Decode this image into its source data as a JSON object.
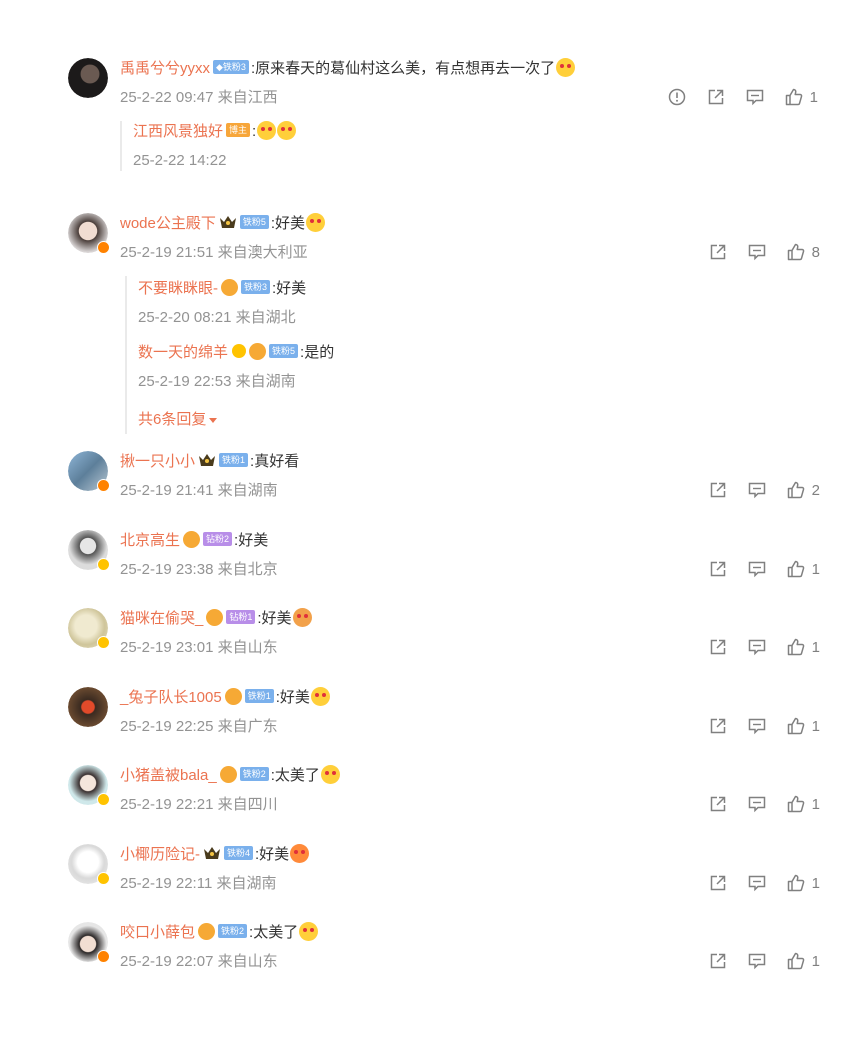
{
  "comments": [
    {
      "user": "禹禹兮兮yyxx",
      "fan_badge": "◆铁粉3",
      "text": ":原来春天的葛仙村这么美，有点想再去一次了",
      "meta": "25-2-22 09:47 来自江西",
      "likes": "1",
      "replies": [
        {
          "user": "江西风景独好",
          "badge": "博主",
          "text": ":",
          "meta": "25-2-22 14:22"
        }
      ]
    },
    {
      "user": "wode公主殿下",
      "fan_badge": "铁粉5",
      "text": ":好美",
      "meta": "25-2-19 21:51 来自澳大利亚",
      "likes": "8",
      "replies": [
        {
          "user": "不要眯眯眼-",
          "badge": "铁粉3",
          "text": ":好美",
          "meta": "25-2-20 08:21 来自湖北"
        },
        {
          "user": "数一天的绵羊",
          "badge": "铁粉5",
          "text": ":是的",
          "meta": "25-2-19 22:53 来自湖南"
        }
      ],
      "more_replies": "共6条回复"
    },
    {
      "user": "揪一只小小",
      "fan_badge": "铁粉1",
      "text": ":真好看",
      "meta": "25-2-19 21:41 来自湖南",
      "likes": "2"
    },
    {
      "user": "北京高生",
      "fan_badge": "钻粉2",
      "text": ":好美",
      "meta": "25-2-19 23:38 来自北京",
      "likes": "1"
    },
    {
      "user": "猫咪在偷哭_",
      "fan_badge": "钻粉1",
      "text": ":好美",
      "meta": "25-2-19 23:01 来自山东",
      "likes": "1"
    },
    {
      "user": "_兔子队长1005",
      "fan_badge": "铁粉1",
      "text": ":好美",
      "meta": "25-2-19 22:25 来自广东",
      "likes": "1"
    },
    {
      "user": "小猪盖被bala_",
      "fan_badge": "铁粉2",
      "text": ":太美了",
      "meta": "25-2-19 22:21 来自四川",
      "likes": "1"
    },
    {
      "user": "小椰历险记-",
      "fan_badge": "铁粉4",
      "text": ":好美",
      "meta": "25-2-19 22:11 来自湖南",
      "likes": "1"
    },
    {
      "user": "咬口小薛包",
      "fan_badge": "铁粉2",
      "text": ":太美了",
      "meta": "25-2-19 22:07 来自山东",
      "likes": "1"
    }
  ],
  "icons": {
    "report": "report-icon",
    "share": "share-icon",
    "comment": "comment-icon",
    "like": "like-icon"
  },
  "colors": {
    "username": "#eb7350",
    "meta": "#939393",
    "text": "#333333"
  }
}
